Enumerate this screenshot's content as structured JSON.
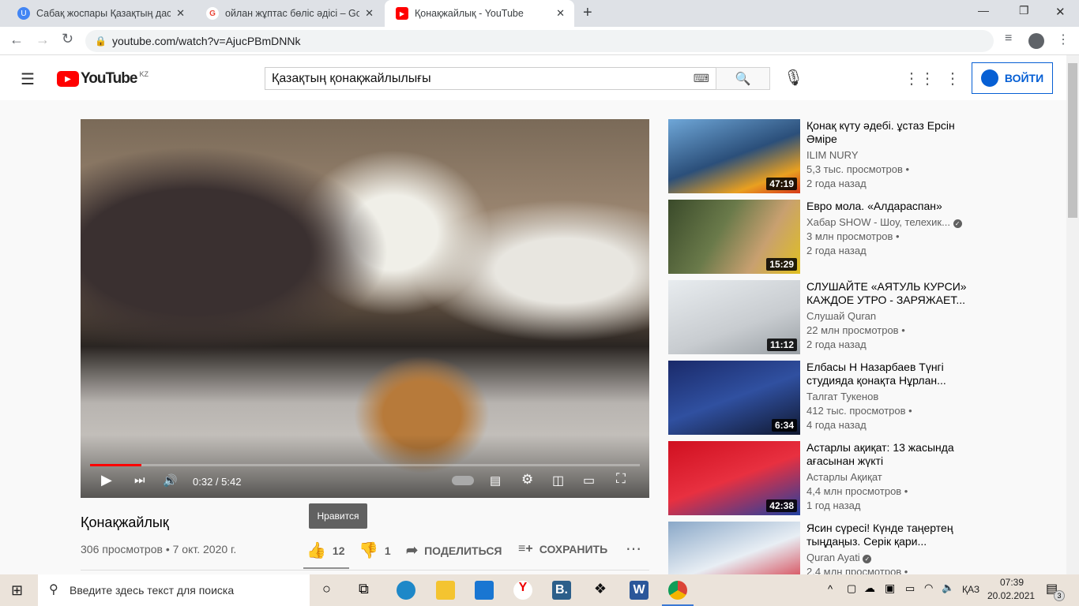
{
  "browser": {
    "tabs": [
      {
        "title": "Сабақ жоспары Қазақтың даста",
        "icon": "U",
        "color": "#4285f4"
      },
      {
        "title": "ойлан жұптас бөліс әдісі – Goog",
        "icon": "G",
        "color": "#ea4335"
      },
      {
        "title": "Қонақжайлық - YouTube",
        "icon": "▶",
        "color": "#ff0000"
      }
    ],
    "url": "youtube.com/watch?v=AjucPBmDNNk"
  },
  "header": {
    "logo": "YouTube",
    "region": "KZ",
    "search_value": "Қазақтың қонақжайлылығы",
    "login": "ВОЙТИ"
  },
  "player": {
    "time": "0:32 / 5:42",
    "progress": 0.093
  },
  "video": {
    "title": "Қонақжайлық",
    "meta": "306 просмотров • 7 окт. 2020 г.",
    "likes": "12",
    "dislikes": "1",
    "share": "ПОДЕЛИТЬСЯ",
    "save": "СОХРАНИТЬ",
    "tooltip": "Нравится"
  },
  "related": [
    {
      "title": "Қонақ күту әдебі. ұстаз Ерсін Әміре",
      "channel": "ILIM NURY",
      "views": "5,3 тыс. просмотров •",
      "age": "2 года назад",
      "duration": "47:19",
      "verified": false,
      "bg": "linear-gradient(160deg,#6fa7d8,#2b4f7a 50%,#e9a020 80%,#d83a1a)"
    },
    {
      "title": "Евро мола. «Алдараспан»",
      "channel": "Хабар SHOW - Шоу, телехик...",
      "views": "3 млн просмотров •",
      "age": "2 года назад",
      "duration": "15:29",
      "verified": true,
      "bg": "linear-gradient(120deg,#3a4a2a,#6a7a4a 40%,#c8a070 70%,#e0c020)"
    },
    {
      "title": "СЛУШАЙТЕ «АЯТУЛЬ КУРСИ» КАЖДОЕ УТРО - ЗАРЯЖАЕТ...",
      "channel": "Слушай Quran",
      "views": "22 млн просмотров •",
      "age": "2 года назад",
      "duration": "11:12",
      "verified": false,
      "bg": "linear-gradient(160deg,#e8ecef,#c8ccd0 60%,#9aa0a5)"
    },
    {
      "title": "Елбасы Н Назарбаев Түнгі студияда қонақта Нұрлан...",
      "channel": "Талгат Тукенов",
      "views": "412 тыс. просмотров •",
      "age": "4 года назад",
      "duration": "6:34",
      "verified": false,
      "bg": "linear-gradient(160deg,#1a2a6a,#3050a0 50%,#101830)"
    },
    {
      "title": "Астарлы ақиқат: 13 жасында ағасынан жүкті",
      "channel": "Астарлы Ақиқат",
      "views": "4,4 млн просмотров •",
      "age": "1 год назад",
      "duration": "42:38",
      "verified": false,
      "bg": "linear-gradient(160deg,#d01020,#e83040 50%,#2040a0)"
    },
    {
      "title": "Ясин сүресі! Күнде таңертең тыңдаңыз. Серік қари...",
      "channel": "Quran Ayati",
      "views": "2,4 млн просмотров •",
      "age": "",
      "duration": "",
      "verified": true,
      "bg": "linear-gradient(160deg,#8aa8c8,#e8eef4 50%,#d01020)"
    }
  ],
  "taskbar": {
    "search_placeholder": "Введите здесь текст для поиска",
    "lang": "ҚАЗ",
    "time": "07:39",
    "date": "20.02.2021",
    "notifications": "3"
  }
}
